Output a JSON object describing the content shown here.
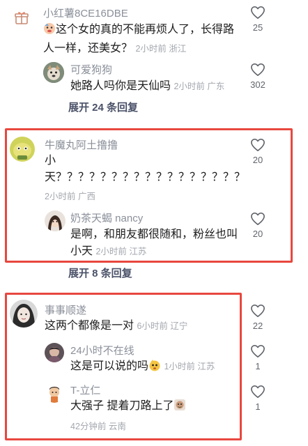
{
  "comments": [
    {
      "user": "小红薯8CE16DBE",
      "text_line1": "这个女的真的不能再烦人了，长得路",
      "text_line2": "人一样，还美女？",
      "time": "2小时前",
      "location": "浙江",
      "likes": "25",
      "replies": [
        {
          "user": "可爱狗狗",
          "text": "她路人吗你是天仙吗",
          "time": "2小时前",
          "location": "广东",
          "likes": "302"
        }
      ],
      "expand_label": "展开 24 条回复"
    },
    {
      "user": "牛魔丸阿土撸撸",
      "text_line1": "小",
      "text_line2": "天？？？？？？？？？？？？？？？？？",
      "time": "2小时前",
      "location": "广西",
      "likes": "20",
      "replies": [
        {
          "user": "奶茶天蝎 nancy",
          "text_line1": "是啊，和朋友都很随和，粉丝也叫",
          "text_line2": "小天",
          "time": "2小时前",
          "location": "江苏",
          "likes": "20"
        }
      ],
      "expand_label": "展开 8 条回复"
    },
    {
      "user": "事事顺遂",
      "text": "这两个都像是一对",
      "time": "6小时前",
      "location": "辽宁",
      "likes": "22",
      "replies": [
        {
          "user": "24小时不在线",
          "text": "这是可以说的吗",
          "time": "1小时前",
          "location": "江苏",
          "likes": "1"
        },
        {
          "user": "T-立仁",
          "text": "大强子 提着刀路上了",
          "time": "42分钟前",
          "location": "云南",
          "likes": "1"
        }
      ]
    }
  ],
  "colors": {
    "highlight_border": "#e8473f",
    "username": "#8a8f99",
    "meta": "#a3a7ae",
    "expand": "#4a5168"
  },
  "icons": [
    "gift-icon",
    "heart-outline-icon",
    "emoji-icon"
  ]
}
